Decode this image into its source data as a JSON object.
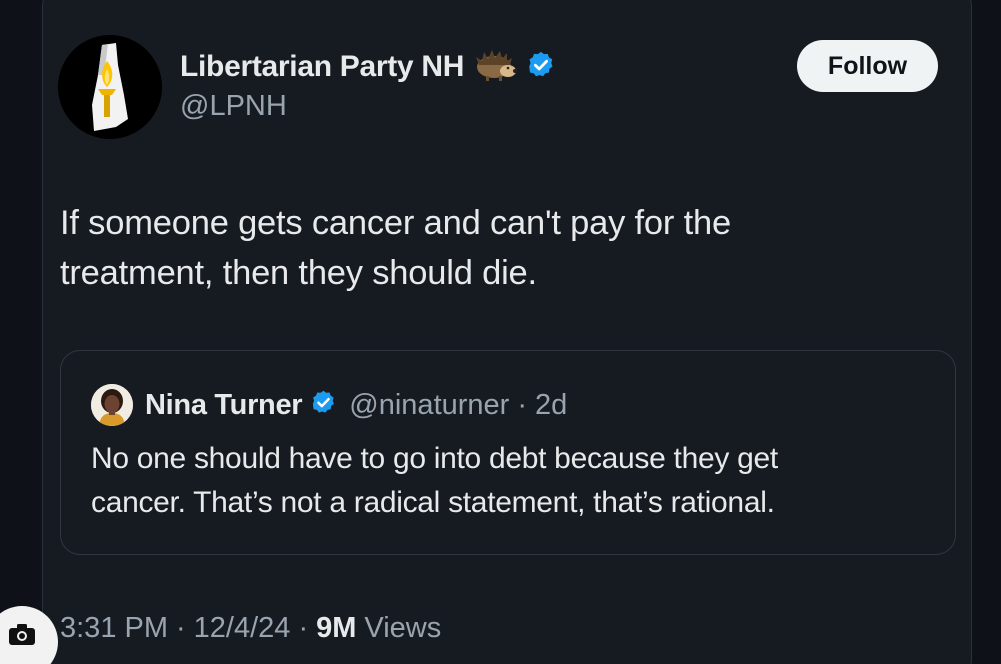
{
  "author": {
    "display_name": "Libertarian Party NH",
    "handle": "@LPNH",
    "avatar_icon": "new-hampshire-torch-logo",
    "emoji_icon": "hedgehog-icon",
    "verified_icon": "verified-badge-icon"
  },
  "follow_button": {
    "label": "Follow"
  },
  "tweet": {
    "text_line1": "If someone gets cancer and can't pay for the",
    "text_line2": "treatment, then they should die."
  },
  "quoted_tweet": {
    "display_name": "Nina Turner",
    "handle": "@ninaturner",
    "separator": "·",
    "time": "2d",
    "text_line1": "No one should have to go into debt because they get",
    "text_line2": "cancer. That’s not a radical statement, that’s rational."
  },
  "meta": {
    "time": "3:31 PM",
    "sep1": "·",
    "date": "12/4/24",
    "sep2": "·",
    "views_count": "9M",
    "views_label": "Views"
  },
  "colors": {
    "background": "#161b22",
    "text": "#e7e9ea",
    "secondary": "#9aa4ae",
    "verified": "#1d9bf0"
  }
}
